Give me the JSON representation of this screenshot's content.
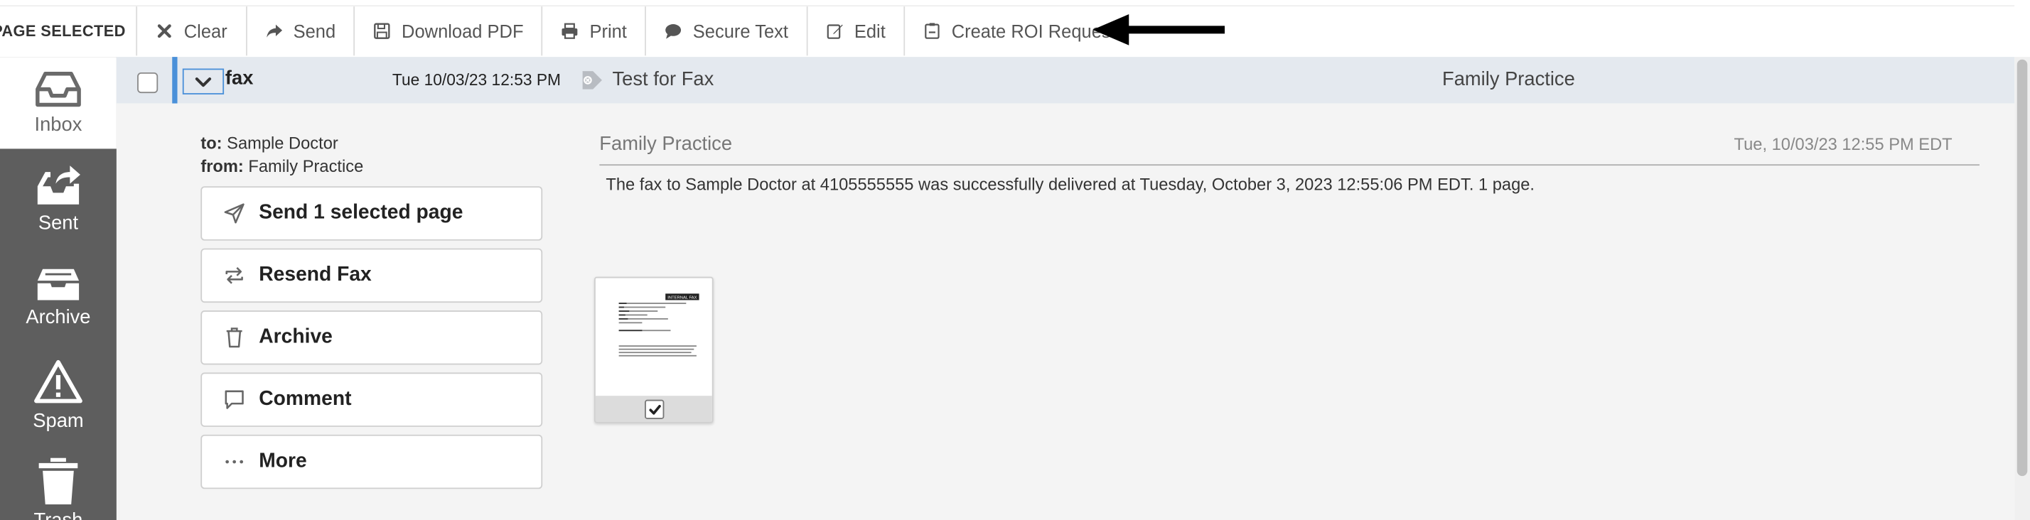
{
  "toolbar": {
    "selection_label": "PAGE SELECTED",
    "buttons": [
      {
        "label": "Clear",
        "icon": "x-icon"
      },
      {
        "label": "Send",
        "icon": "share-arrow-icon"
      },
      {
        "label": "Download PDF",
        "icon": "floppy-disk-icon"
      },
      {
        "label": "Print",
        "icon": "printer-icon"
      },
      {
        "label": "Secure Text",
        "icon": "chat-bubble-icon"
      },
      {
        "label": "Edit",
        "icon": "edit-icon"
      },
      {
        "label": "Create ROI Request",
        "icon": "roi-document-icon"
      }
    ]
  },
  "sidebar": {
    "items": [
      {
        "label": "Inbox",
        "icon": "inbox-icon",
        "active": true
      },
      {
        "label": "Sent",
        "icon": "sent-icon",
        "active": false
      },
      {
        "label": "Archive",
        "icon": "archive-icon",
        "active": false
      },
      {
        "label": "Spam",
        "icon": "warning-icon",
        "active": false
      },
      {
        "label": "Trash",
        "icon": "trash-icon",
        "active": false
      }
    ]
  },
  "message": {
    "type": "fax",
    "date": "Tue 10/03/23 12:53 PM",
    "subject": "Test for Fax",
    "from_name": "Family Practice"
  },
  "detail": {
    "to_label": "to:",
    "to_value": "Sample Doctor",
    "from_label": "from:",
    "from_value": "Family Practice",
    "actions": [
      {
        "label": "Send 1 selected page",
        "icon": "paper-plane-icon"
      },
      {
        "label": "Resend Fax",
        "icon": "repeat-icon"
      },
      {
        "label": "Archive",
        "icon": "trash-can-icon"
      },
      {
        "label": "Comment",
        "icon": "comment-icon"
      },
      {
        "label": "More",
        "icon": "ellipsis-icon"
      }
    ],
    "header_from": "Family Practice",
    "header_date": "Tue, 10/03/23 12:55 PM EDT",
    "status_message": "The fax to Sample Doctor at 4105555555  was successfully delivered at Tuesday, October 3, 2023 12:55:06 PM EDT. 1 page.",
    "thumbnail_badge": "INTERNAL FAX"
  },
  "colors": {
    "sidebar_bg": "#5e5e5e",
    "row_bg": "#e4e9ef",
    "accent": "#4a90d9",
    "panel_bg": "#f4f4f4"
  }
}
